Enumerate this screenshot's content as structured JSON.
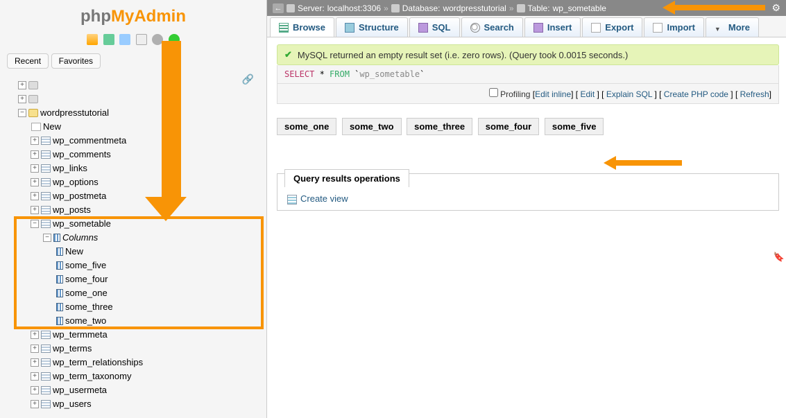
{
  "logo": {
    "php": "php",
    "myadmin": "MyAdmin"
  },
  "recent_label": "Recent",
  "favorites_label": "Favorites",
  "tree": {
    "db": "wordpresstutorial",
    "new": "New",
    "tables": [
      "wp_commentmeta",
      "wp_comments",
      "wp_links",
      "wp_options",
      "wp_postmeta",
      "wp_posts"
    ],
    "sometable": "wp_sometable",
    "columns_label": "Columns",
    "col_new": "New",
    "columns": [
      "some_five",
      "some_four",
      "some_one",
      "some_three",
      "some_two"
    ],
    "tables2": [
      "wp_termmeta",
      "wp_terms",
      "wp_term_relationships",
      "wp_term_taxonomy",
      "wp_usermeta",
      "wp_users"
    ]
  },
  "breadcrumb": {
    "server_label": "Server:",
    "server_val": "localhost:3306",
    "db_label": "Database:",
    "db_val": "wordpresstutorial",
    "table_label": "Table:",
    "table_val": "wp_sometable"
  },
  "tabs": {
    "browse": "Browse",
    "structure": "Structure",
    "sql": "SQL",
    "search": "Search",
    "insert": "Insert",
    "export": "Export",
    "import": "Import",
    "more": "More"
  },
  "msg": "MySQL returned an empty result set (i.e. zero rows). (Query took 0.0015 seconds.)",
  "sql": {
    "select": "SELECT",
    "star": " * ",
    "from": "FROM",
    "tick": " `",
    "name": "wp_sometable",
    "tick2": "`"
  },
  "links": {
    "profiling": "Profiling",
    "edit_inline": "Edit inline",
    "edit": "Edit",
    "explain": "Explain SQL",
    "create_php": "Create PHP code",
    "refresh": "Refresh"
  },
  "result_cols": [
    "some_one",
    "some_two",
    "some_three",
    "some_four",
    "some_five"
  ],
  "qro": {
    "title": "Query results operations",
    "create_view": "Create view"
  }
}
